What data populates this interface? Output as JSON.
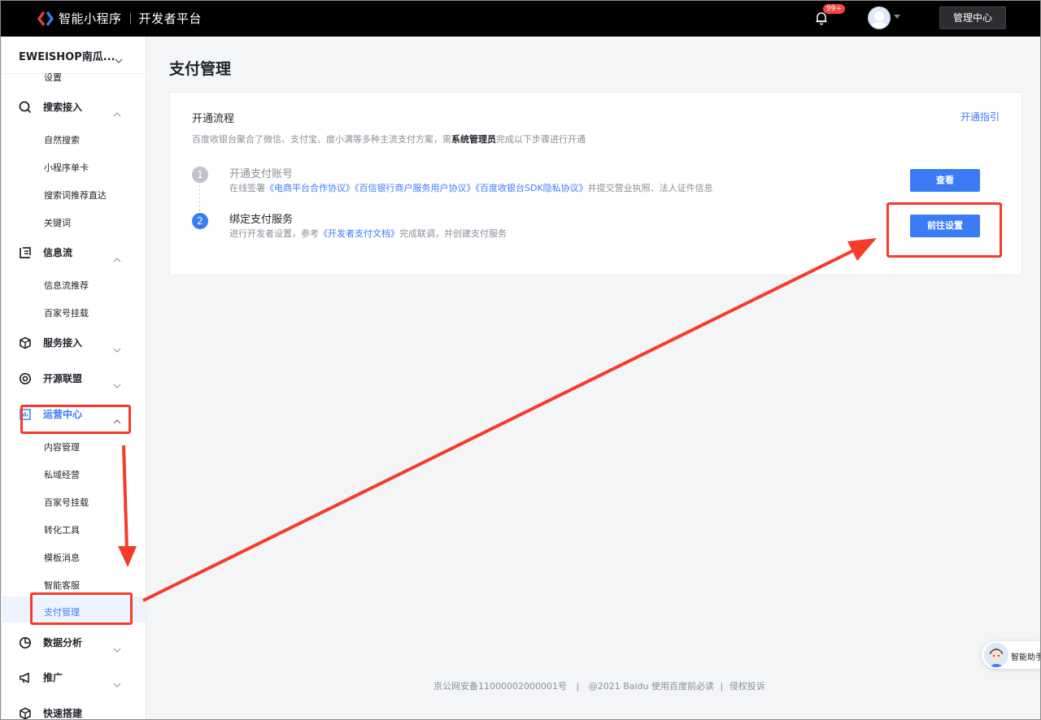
{
  "topbar": {
    "brand": "智能小程序",
    "platform": "开发者平台",
    "notification_badge": "99+",
    "admin_button": "管理中心"
  },
  "sidebar": {
    "app_name": "EWEISHOP南瓜...",
    "partial_item": "设置",
    "groups": [
      {
        "label": "搜索接入",
        "icon": "search-icon",
        "items": [
          "自然搜索",
          "小程序单卡",
          "搜索词推荐直达",
          "关键词"
        ]
      },
      {
        "label": "信息流",
        "icon": "feed-icon",
        "items": [
          "信息流推荐",
          "百家号挂载"
        ]
      },
      {
        "label": "服务接入",
        "icon": "service-icon",
        "items": []
      },
      {
        "label": "开源联盟",
        "icon": "open-source-icon",
        "items": []
      },
      {
        "label": "运营中心",
        "icon": "operations-icon",
        "items": [
          "内容管理",
          "私域经营",
          "百家号挂载",
          "转化工具",
          "模板消息",
          "智能客服",
          "支付管理"
        ]
      },
      {
        "label": "数据分析",
        "icon": "pie-chart-icon",
        "items": []
      },
      {
        "label": "推广",
        "icon": "megaphone-icon",
        "items": []
      },
      {
        "label": "快速搭建",
        "icon": "cube-icon",
        "items": []
      }
    ],
    "active_item": "支付管理"
  },
  "main": {
    "page_title": "支付管理",
    "card": {
      "title": "开通流程",
      "guide_link": "开通指引",
      "desc_before": "百度收银台聚合了微信、支付宝、度小满等多种主流支付方案，需",
      "desc_bold": "系统管理员",
      "desc_after": "完成以下步骤进行开通",
      "steps": [
        {
          "num": "1",
          "title": "开通支付账号",
          "desc_prefix": "在线签署",
          "links": [
            "《电商平台合作协议》",
            "《百信银行商户服务用户协议》",
            "《百度收银台SDK隐私协议》"
          ],
          "desc_suffix": "并提交营业执照、法人证件信息",
          "button": "查看"
        },
        {
          "num": "2",
          "title": "绑定支付服务",
          "desc_prefix": "进行开发者设置，参考",
          "links": [
            "《开发者支付文档》"
          ],
          "desc_suffix": "完成联调，并创建支付服务",
          "button": "前往设置"
        }
      ]
    }
  },
  "footer": {
    "icp": "京公网安备11000002000001号",
    "copyright": "@2021 Baidu 使用百度前必读",
    "report": "侵权投诉"
  },
  "assistant": {
    "label": "智能助手"
  },
  "colors": {
    "accent": "#3b7cf6",
    "annotation": "#f53c2a",
    "topbar": "#000000"
  }
}
